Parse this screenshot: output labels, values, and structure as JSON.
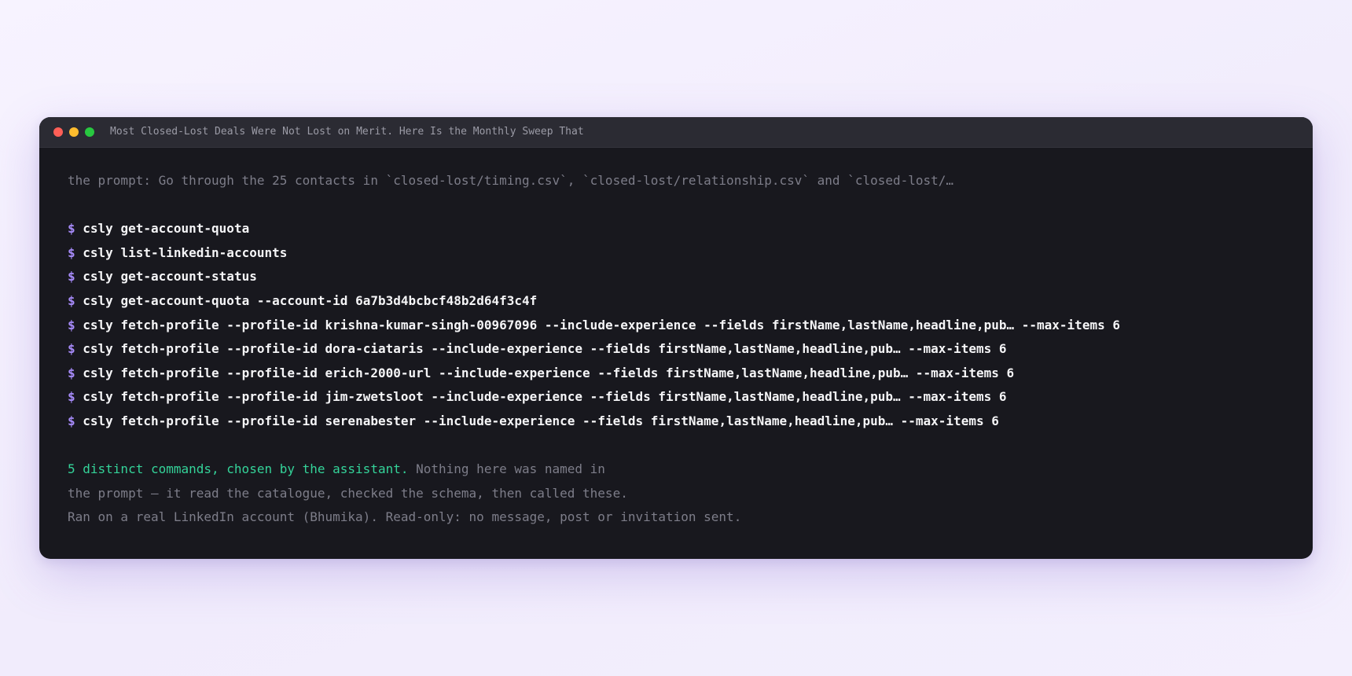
{
  "window": {
    "title": "Most Closed-Lost Deals Were Not Lost on Merit. Here Is the Monthly Sweep That"
  },
  "terminal": {
    "prompt_line": "the prompt: Go through the 25 contacts in `closed-lost/timing.csv`, `closed-lost/relationship.csv` and `closed-lost/…",
    "prompt_symbol": "$",
    "commands": [
      "csly get-account-quota",
      "csly list-linkedin-accounts",
      "csly get-account-status",
      "csly get-account-quota --account-id 6a7b3d4bcbcf48b2d64f3c4f",
      "csly fetch-profile --profile-id krishna-kumar-singh-00967096 --include-experience --fields firstName,lastName,headline,pub… --max-items 6",
      "csly fetch-profile --profile-id dora-ciataris --include-experience --fields firstName,lastName,headline,pub… --max-items 6",
      "csly fetch-profile --profile-id erich-2000-url --include-experience --fields firstName,lastName,headline,pub… --max-items 6",
      "csly fetch-profile --profile-id jim-zwetsloot --include-experience --fields firstName,lastName,headline,pub… --max-items 6",
      "csly fetch-profile --profile-id serenabester --include-experience --fields firstName,lastName,headline,pub… --max-items 6"
    ],
    "summary": {
      "highlight": "5 distinct commands, chosen by the assistant.",
      "line1_rest": " Nothing here was named in",
      "line2": "the prompt — it read the catalogue, checked the schema, then called these.",
      "line3": "Ran on a real LinkedIn account (Bhumika). Read-only: no message, post or invitation sent."
    }
  },
  "colors": {
    "terminal_bg": "#18181e",
    "titlebar_bg": "#2b2b33",
    "prompt_symbol": "#a78bfa",
    "highlight": "#34d399",
    "muted_text": "#7d7d89",
    "command_text": "#f5f5f7"
  }
}
